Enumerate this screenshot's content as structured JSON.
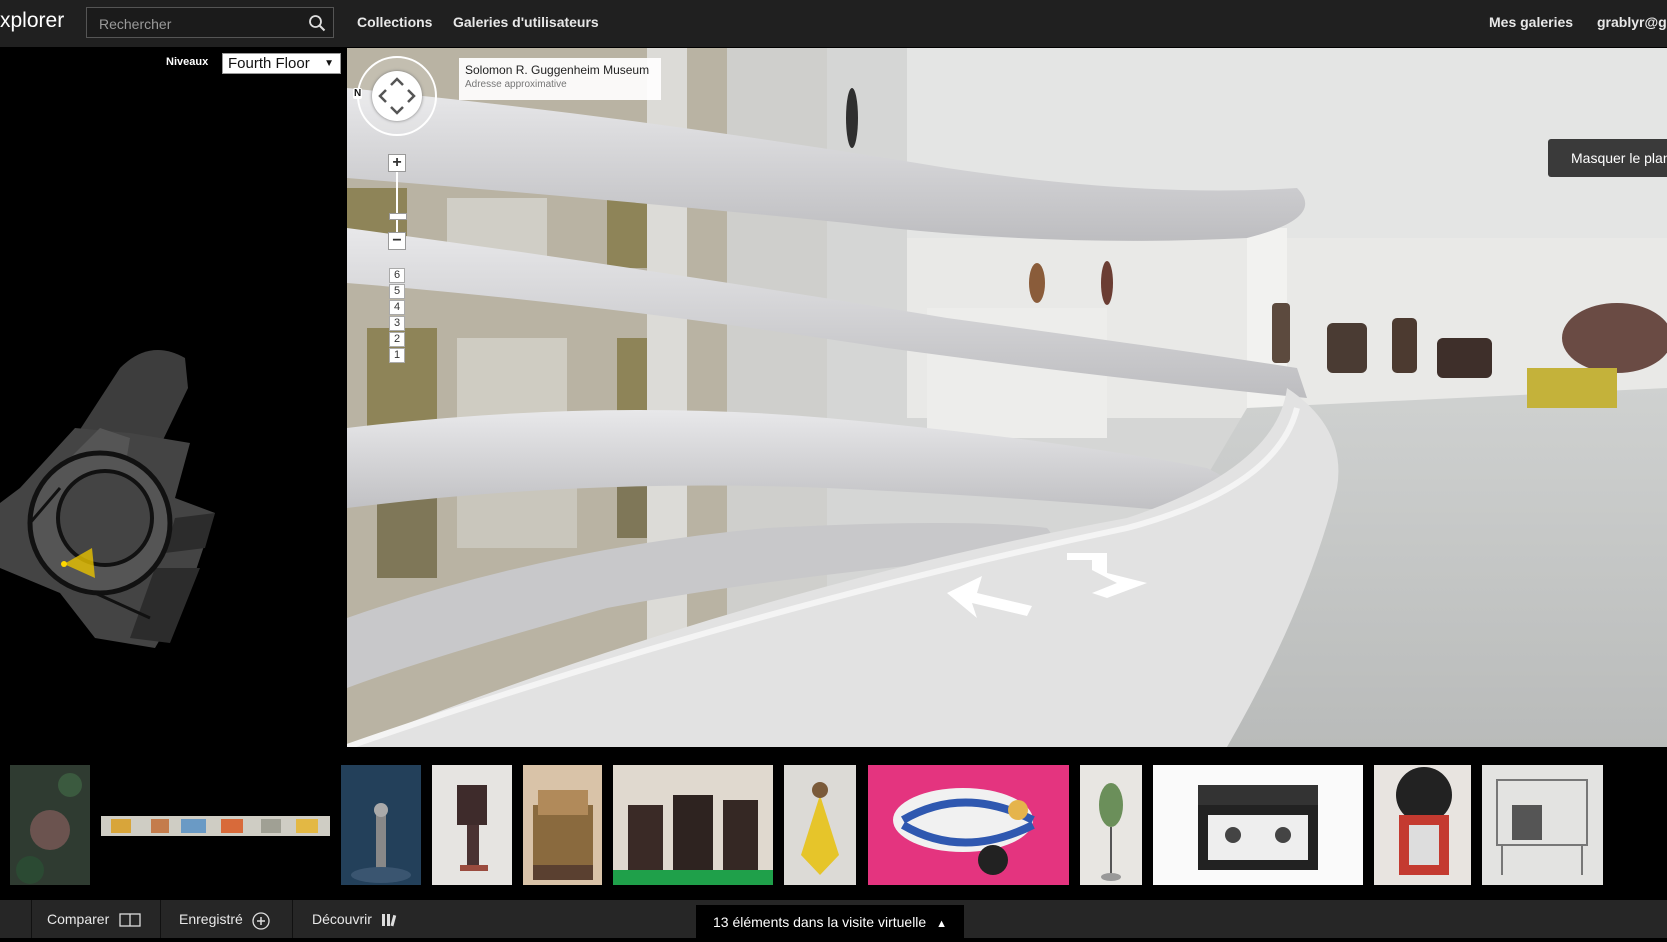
{
  "header": {
    "logo": "xplorer",
    "search_placeholder": "Rechercher",
    "nav": [
      "Collections",
      "Galeries d'utilisateurs"
    ],
    "my_galleries": "Mes galeries",
    "user": "grablyr@gr"
  },
  "floor_panel": {
    "levels_label": "Niveaux",
    "selected_level": "Fourth Floor"
  },
  "viewer": {
    "location_title": "Solomon R. Guggenheim Museum",
    "location_subtitle": "Adresse approximative",
    "compass_north": "N",
    "zoom_in": "+",
    "zoom_out": "−",
    "floors": [
      "6",
      "5",
      "4",
      "3",
      "2",
      "1"
    ],
    "hide_map": "Masquer le plan"
  },
  "bottom_bar": {
    "compare": "Comparer",
    "saved": "Enregistré",
    "discover": "Découvrir",
    "tour_items": "13 éléments dans la visite virtuelle"
  }
}
